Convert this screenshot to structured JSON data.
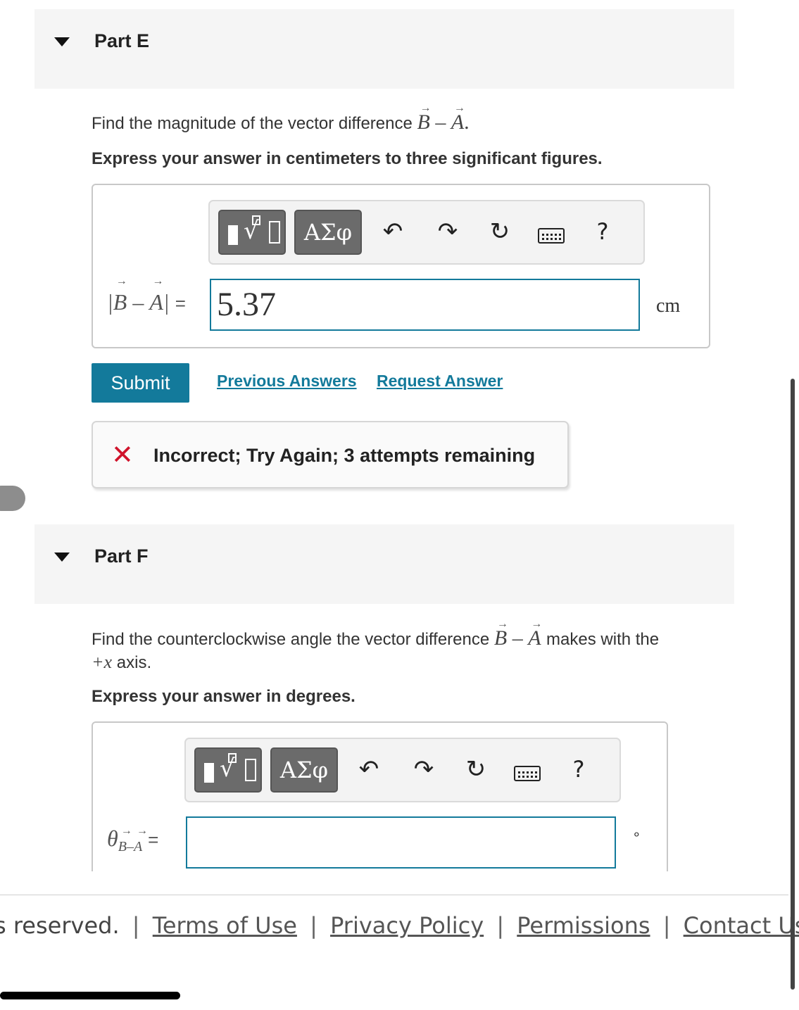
{
  "partE": {
    "title": "Part E",
    "prompt_pre": "Find the magnitude of the vector difference",
    "prompt_vec1": "B",
    "prompt_minus": "–",
    "prompt_vec2": "A",
    "prompt_post": ".",
    "instruction": "Express your answer in centimeters to three significant figures.",
    "toolbar": {
      "greek_label": "ΑΣφ",
      "undo": "↶",
      "redo": "↷",
      "reset": "↻",
      "help": "?"
    },
    "label": "|B – A|",
    "label_bar_left": "|",
    "label_b": "B",
    "label_minus": " – ",
    "label_a": "A",
    "label_bar_right": "|",
    "equals": "=",
    "answer_value": "5.37",
    "unit": "cm",
    "submit_label": "Submit",
    "previous_answers": "Previous Answers",
    "request_answer": "Request Answer",
    "feedback_icon": "✕",
    "feedback": "Incorrect; Try Again; 3 attempts remaining"
  },
  "partF": {
    "title": "Part F",
    "prompt_pre": "Find the counterclockwise angle the vector difference",
    "prompt_vec1": "B",
    "prompt_minus": "–",
    "prompt_vec2": "A",
    "prompt_post": "makes with the",
    "prompt_line2_var": "+x",
    "prompt_line2_rest": " axis.",
    "instruction": "Express your answer in degrees.",
    "toolbar": {
      "greek_label": "ΑΣφ",
      "undo": "↶",
      "redo": "↷",
      "reset": "↻",
      "help": "?"
    },
    "theta": "θ",
    "sub_b": "B",
    "sub_minus": "–",
    "sub_a": "A",
    "equals": "=",
    "answer_value": "",
    "unit": "∘"
  },
  "footer": {
    "text": "s reserved.",
    "links": [
      "Terms of Use",
      "Privacy Policy",
      "Permissions",
      "Contact Us"
    ],
    "separator": "|"
  },
  "icons": [
    "caret-down-icon",
    "template-icon",
    "greek-icon",
    "undo-icon",
    "redo-icon",
    "reset-icon",
    "keyboard-icon",
    "help-icon",
    "incorrect-x-icon"
  ],
  "colors": {
    "accent": "#137a9b",
    "error": "#d0142c",
    "header_bg": "#f5f5f5"
  }
}
